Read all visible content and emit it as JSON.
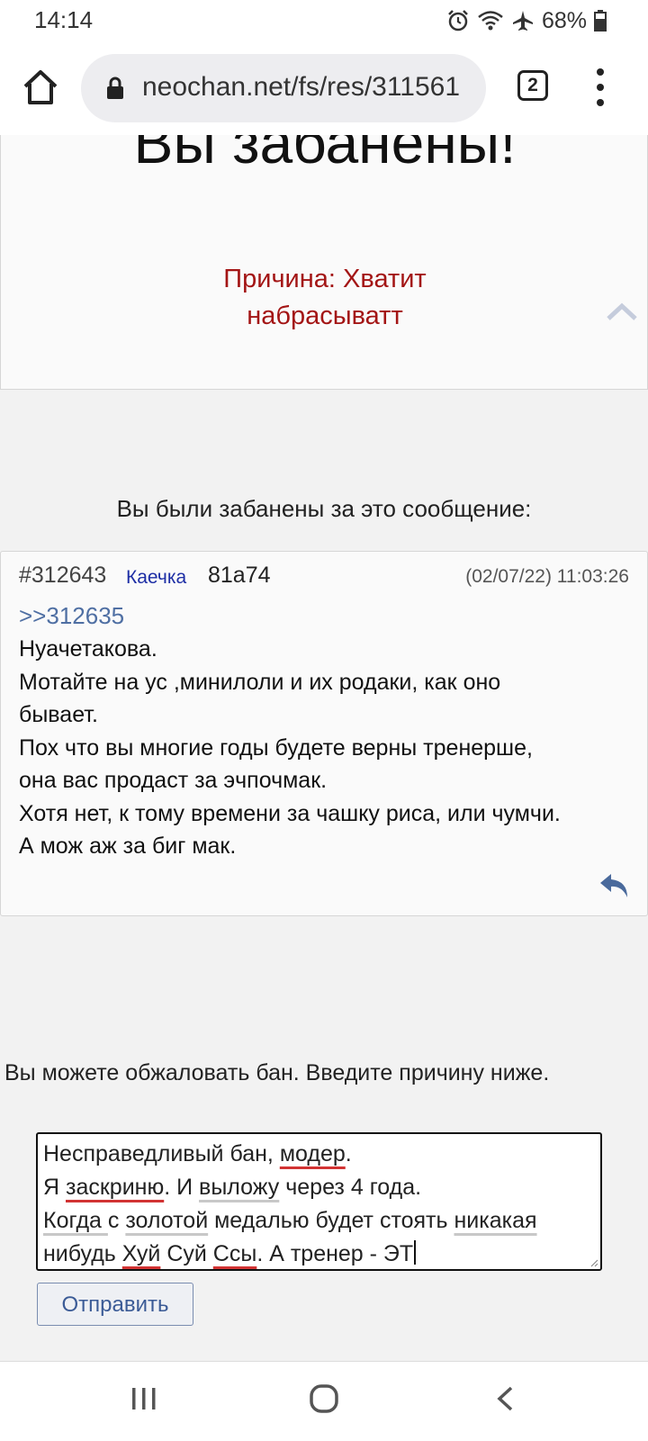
{
  "status_bar": {
    "time": "14:14",
    "battery": "68%",
    "icons": [
      "alarm-icon",
      "wifi-icon",
      "airplane-icon",
      "battery-icon"
    ]
  },
  "browser": {
    "url": "neochan.net/fs/res/311561",
    "tab_count": "2"
  },
  "ban": {
    "title": "Вы забанены!",
    "reason_line1": "Причина:  Хватит",
    "reason_line2": "набрасыватт",
    "banned_for_label": "Вы были забанены за это сообщение:"
  },
  "post": {
    "number": "#312643",
    "name": "Каечка",
    "id": "81a74",
    "date": "(02/07/22) 11:03:26",
    "reply_ref": ">>312635",
    "lines": [
      "Нуачетакова.",
      "Мотайте на ус ,минилоли и их родаки, как оно",
      "бывает.",
      "Пох что вы многие годы будете верны тренерше,",
      "она вас продаст за эчпочмак.",
      "Хотя нет, к тому времени за чашку риса, или чумчи.",
      "А мож аж за биг мак."
    ]
  },
  "appeal": {
    "label": "Вы можете обжаловать бан. Введите причину ниже.",
    "text": {
      "l1_a": "Несправедливый бан, ",
      "l1_b": "модер",
      "l1_c": ".",
      "l2_a": "Я ",
      "l2_b": "заскриню",
      "l2_c": ". И ",
      "l2_d": "выложу",
      "l2_e": " через 4 года.",
      "l3_a": "Когда ",
      "l3_b": " с ",
      "l3_c": "золотой",
      "l3_d": " медалью будет стоять ",
      "l3_e": "никакая",
      "l4_a": "нибудь ",
      "l4_b": "Хуй",
      "l4_c": " Суй ",
      "l4_d": "Ссы",
      "l4_e": ". А тренер - ЭТ"
    },
    "submit_label": "Отправить"
  },
  "colors": {
    "reason": "#a31515",
    "link": "#4f6fa3",
    "name": "#1d2ea5",
    "button_text": "#3b5b96"
  }
}
